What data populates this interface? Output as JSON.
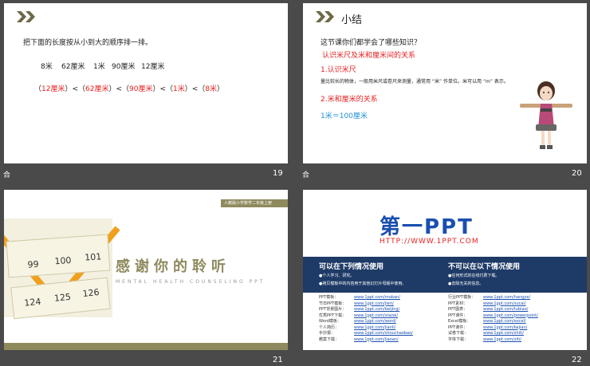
{
  "slides": [
    {
      "number": "19",
      "tag": "合",
      "instruction": "把下面的长度按从小到大的顺序排一排。",
      "items": [
        "8米",
        "62厘米",
        "1米",
        "90厘米",
        "12厘米"
      ],
      "answer": {
        "p1": "（",
        "a1": "12厘米",
        "p2": "）<（",
        "a2": "62厘米",
        "p3": "）<（",
        "a3": "90厘米",
        "p4": "）<（",
        "a4": "1米",
        "p5": "）<（",
        "a5": "8米",
        "p6": "）"
      }
    },
    {
      "number": "20",
      "tag": "合",
      "title": "小结",
      "question": "这节课你们都学会了哪些知识？",
      "subtitle": "认识米尺及米和厘米间的关系",
      "section1": "1.认识米尺",
      "body": "量比较长的物体，一般用米尺或卷尺来测量，通常用 “米” 作单位。米可以用 “m” 表示。",
      "section2": "2.米和厘米的关系",
      "relation": "1米＝100厘米"
    },
    {
      "number": "21",
      "tag_text": "人教版小学数学二年级上册",
      "thanks": "感谢你的聆听",
      "subtitle": "MENTAL HEALTH COUNSELING PPT",
      "ruler_nums": [
        "99",
        "100",
        "101",
        "124",
        "125",
        "126"
      ]
    },
    {
      "number": "22",
      "logo_main": "第一PPT",
      "logo_url": "HTTP://WWW.1PPT.COM",
      "allowed_title": "可以在下列情况使用",
      "allowed_items": [
        "●个人学习、研究。",
        "●拷贝模板中的内容用于其他幻灯片母版中使用。"
      ],
      "forbidden_title": "不可以在以下情况使用",
      "forbidden_items": [
        "●任何形式的在线付费下载。",
        "●去除无关的信息。"
      ],
      "left_links": [
        {
          "label": "PPT模板：",
          "url": "www.1ppt.com/moban/"
        },
        {
          "label": "节日PPT模板：",
          "url": "www.1ppt.com/jieri/"
        },
        {
          "label": "PPT背景图片：",
          "url": "www.1ppt.com/beijing/"
        },
        {
          "label": "优秀PPT下载：",
          "url": "www.1ppt.com/xiazai/"
        },
        {
          "label": "Word模板：",
          "url": "www.1ppt.com/word/"
        },
        {
          "label": "个人简历：",
          "url": "www.1ppt.com/jianli/"
        },
        {
          "label": "手抄报：",
          "url": "www.1ppt.com/shouchaobao/"
        },
        {
          "label": "教案下载：",
          "url": "www.1ppt.com/jiaoan/"
        }
      ],
      "right_links": [
        {
          "label": "行业PPT模板：",
          "url": "www.1ppt.com/hangye/"
        },
        {
          "label": "PPT素材：",
          "url": "www.1ppt.com/sucai/"
        },
        {
          "label": "PPT图表：",
          "url": "www.1ppt.com/tubiao/"
        },
        {
          "label": "PPT课件：",
          "url": "www.1ppt.com/powerpoint/"
        },
        {
          "label": "Excel模板：",
          "url": "www.1ppt.com/excel/"
        },
        {
          "label": "PPT课件：",
          "url": "www.1ppt.com/kejian/"
        },
        {
          "label": "试卷下载：",
          "url": "www.1ppt.com/shiti/"
        },
        {
          "label": "字体下载：",
          "url": "www.1ppt.com/ziti/"
        }
      ]
    }
  ]
}
